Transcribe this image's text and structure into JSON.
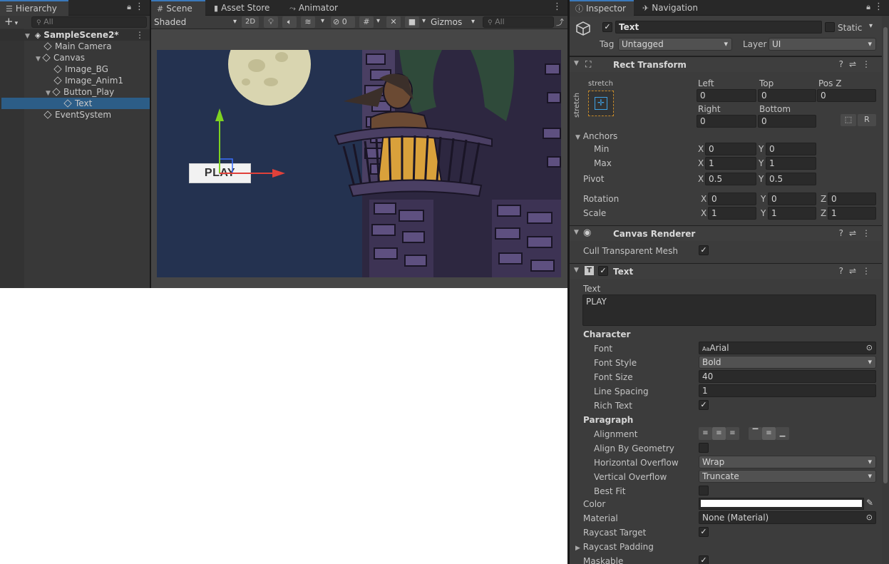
{
  "hierarchy": {
    "tab": "Hierarchy",
    "search_placeholder": "All",
    "add_label": "+",
    "items": [
      {
        "label": "SampleScene2*"
      },
      {
        "label": "Main Camera"
      },
      {
        "label": "Canvas"
      },
      {
        "label": "Image_BG"
      },
      {
        "label": "Image_Anim1"
      },
      {
        "label": "Button_Play"
      },
      {
        "label": "Text"
      },
      {
        "label": "EventSystem"
      }
    ]
  },
  "scene": {
    "tabs": [
      "Scene",
      "Asset Store",
      "Animator"
    ],
    "shading": "Shaded",
    "mode_2d": "2D",
    "hidden_count": "0",
    "gizmos": "Gizmos",
    "search_placeholder": "All",
    "button_text": "PLAY"
  },
  "inspector": {
    "tabs": [
      "Inspector",
      "Navigation"
    ],
    "object_name": "Text",
    "static_label": "Static",
    "tag_label": "Tag",
    "tag_value": "Untagged",
    "layer_label": "Layer",
    "layer_value": "UI",
    "rect_transform": {
      "title": "Rect Transform",
      "anchor_preset": "stretch",
      "left_label": "Left",
      "left": "0",
      "top_label": "Top",
      "top": "0",
      "posz_label": "Pos Z",
      "posz": "0",
      "right_label": "Right",
      "right": "0",
      "bottom_label": "Bottom",
      "bottom": "0",
      "r_button": "R",
      "anchors_label": "Anchors",
      "min_label": "Min",
      "min_x": "0",
      "min_y": "0",
      "max_label": "Max",
      "max_x": "1",
      "max_y": "1",
      "pivot_label": "Pivot",
      "pivot_x": "0.5",
      "pivot_y": "0.5",
      "rotation_label": "Rotation",
      "rot_x": "0",
      "rot_y": "0",
      "rot_z": "0",
      "scale_label": "Scale",
      "scale_x": "1",
      "scale_y": "1",
      "scale_z": "1"
    },
    "canvas_renderer": {
      "title": "Canvas Renderer",
      "cull_label": "Cull Transparent Mesh"
    },
    "text_component": {
      "title": "Text",
      "text_label": "Text",
      "text_value": "PLAY",
      "character_label": "Character",
      "font_label": "Font",
      "font_value": "Arial",
      "font_style_label": "Font Style",
      "font_style_value": "Bold",
      "font_size_label": "Font Size",
      "font_size_value": "40",
      "line_spacing_label": "Line Spacing",
      "line_spacing_value": "1",
      "rich_text_label": "Rich Text",
      "paragraph_label": "Paragraph",
      "alignment_label": "Alignment",
      "align_geometry_label": "Align By Geometry",
      "h_overflow_label": "Horizontal Overflow",
      "h_overflow_value": "Wrap",
      "v_overflow_label": "Vertical Overflow",
      "v_overflow_value": "Truncate",
      "best_fit_label": "Best Fit",
      "color_label": "Color",
      "material_label": "Material",
      "material_value": "None (Material)",
      "raycast_target_label": "Raycast Target",
      "raycast_padding_label": "Raycast Padding",
      "maskable_label": "Maskable"
    }
  },
  "axes_labels": {
    "x": "X",
    "y": "Y",
    "z": "Z"
  },
  "colors": {
    "selection": "#2c5d87",
    "accent_tab": "#3a79bb",
    "scene_sky": "#243250",
    "gizmo_x": "#e0413a",
    "gizmo_y": "#7ed321"
  }
}
